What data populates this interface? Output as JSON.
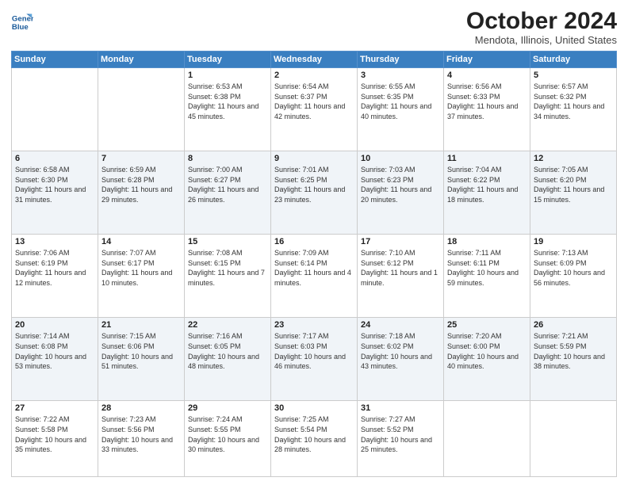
{
  "logo": {
    "line1": "General",
    "line2": "Blue"
  },
  "title": "October 2024",
  "location": "Mendota, Illinois, United States",
  "headers": [
    "Sunday",
    "Monday",
    "Tuesday",
    "Wednesday",
    "Thursday",
    "Friday",
    "Saturday"
  ],
  "weeks": [
    [
      {
        "num": "",
        "detail": ""
      },
      {
        "num": "",
        "detail": ""
      },
      {
        "num": "1",
        "detail": "Sunrise: 6:53 AM\nSunset: 6:38 PM\nDaylight: 11 hours and 45 minutes."
      },
      {
        "num": "2",
        "detail": "Sunrise: 6:54 AM\nSunset: 6:37 PM\nDaylight: 11 hours and 42 minutes."
      },
      {
        "num": "3",
        "detail": "Sunrise: 6:55 AM\nSunset: 6:35 PM\nDaylight: 11 hours and 40 minutes."
      },
      {
        "num": "4",
        "detail": "Sunrise: 6:56 AM\nSunset: 6:33 PM\nDaylight: 11 hours and 37 minutes."
      },
      {
        "num": "5",
        "detail": "Sunrise: 6:57 AM\nSunset: 6:32 PM\nDaylight: 11 hours and 34 minutes."
      }
    ],
    [
      {
        "num": "6",
        "detail": "Sunrise: 6:58 AM\nSunset: 6:30 PM\nDaylight: 11 hours and 31 minutes."
      },
      {
        "num": "7",
        "detail": "Sunrise: 6:59 AM\nSunset: 6:28 PM\nDaylight: 11 hours and 29 minutes."
      },
      {
        "num": "8",
        "detail": "Sunrise: 7:00 AM\nSunset: 6:27 PM\nDaylight: 11 hours and 26 minutes."
      },
      {
        "num": "9",
        "detail": "Sunrise: 7:01 AM\nSunset: 6:25 PM\nDaylight: 11 hours and 23 minutes."
      },
      {
        "num": "10",
        "detail": "Sunrise: 7:03 AM\nSunset: 6:23 PM\nDaylight: 11 hours and 20 minutes."
      },
      {
        "num": "11",
        "detail": "Sunrise: 7:04 AM\nSunset: 6:22 PM\nDaylight: 11 hours and 18 minutes."
      },
      {
        "num": "12",
        "detail": "Sunrise: 7:05 AM\nSunset: 6:20 PM\nDaylight: 11 hours and 15 minutes."
      }
    ],
    [
      {
        "num": "13",
        "detail": "Sunrise: 7:06 AM\nSunset: 6:19 PM\nDaylight: 11 hours and 12 minutes."
      },
      {
        "num": "14",
        "detail": "Sunrise: 7:07 AM\nSunset: 6:17 PM\nDaylight: 11 hours and 10 minutes."
      },
      {
        "num": "15",
        "detail": "Sunrise: 7:08 AM\nSunset: 6:15 PM\nDaylight: 11 hours and 7 minutes."
      },
      {
        "num": "16",
        "detail": "Sunrise: 7:09 AM\nSunset: 6:14 PM\nDaylight: 11 hours and 4 minutes."
      },
      {
        "num": "17",
        "detail": "Sunrise: 7:10 AM\nSunset: 6:12 PM\nDaylight: 11 hours and 1 minute."
      },
      {
        "num": "18",
        "detail": "Sunrise: 7:11 AM\nSunset: 6:11 PM\nDaylight: 10 hours and 59 minutes."
      },
      {
        "num": "19",
        "detail": "Sunrise: 7:13 AM\nSunset: 6:09 PM\nDaylight: 10 hours and 56 minutes."
      }
    ],
    [
      {
        "num": "20",
        "detail": "Sunrise: 7:14 AM\nSunset: 6:08 PM\nDaylight: 10 hours and 53 minutes."
      },
      {
        "num": "21",
        "detail": "Sunrise: 7:15 AM\nSunset: 6:06 PM\nDaylight: 10 hours and 51 minutes."
      },
      {
        "num": "22",
        "detail": "Sunrise: 7:16 AM\nSunset: 6:05 PM\nDaylight: 10 hours and 48 minutes."
      },
      {
        "num": "23",
        "detail": "Sunrise: 7:17 AM\nSunset: 6:03 PM\nDaylight: 10 hours and 46 minutes."
      },
      {
        "num": "24",
        "detail": "Sunrise: 7:18 AM\nSunset: 6:02 PM\nDaylight: 10 hours and 43 minutes."
      },
      {
        "num": "25",
        "detail": "Sunrise: 7:20 AM\nSunset: 6:00 PM\nDaylight: 10 hours and 40 minutes."
      },
      {
        "num": "26",
        "detail": "Sunrise: 7:21 AM\nSunset: 5:59 PM\nDaylight: 10 hours and 38 minutes."
      }
    ],
    [
      {
        "num": "27",
        "detail": "Sunrise: 7:22 AM\nSunset: 5:58 PM\nDaylight: 10 hours and 35 minutes."
      },
      {
        "num": "28",
        "detail": "Sunrise: 7:23 AM\nSunset: 5:56 PM\nDaylight: 10 hours and 33 minutes."
      },
      {
        "num": "29",
        "detail": "Sunrise: 7:24 AM\nSunset: 5:55 PM\nDaylight: 10 hours and 30 minutes."
      },
      {
        "num": "30",
        "detail": "Sunrise: 7:25 AM\nSunset: 5:54 PM\nDaylight: 10 hours and 28 minutes."
      },
      {
        "num": "31",
        "detail": "Sunrise: 7:27 AM\nSunset: 5:52 PM\nDaylight: 10 hours and 25 minutes."
      },
      {
        "num": "",
        "detail": ""
      },
      {
        "num": "",
        "detail": ""
      }
    ]
  ]
}
